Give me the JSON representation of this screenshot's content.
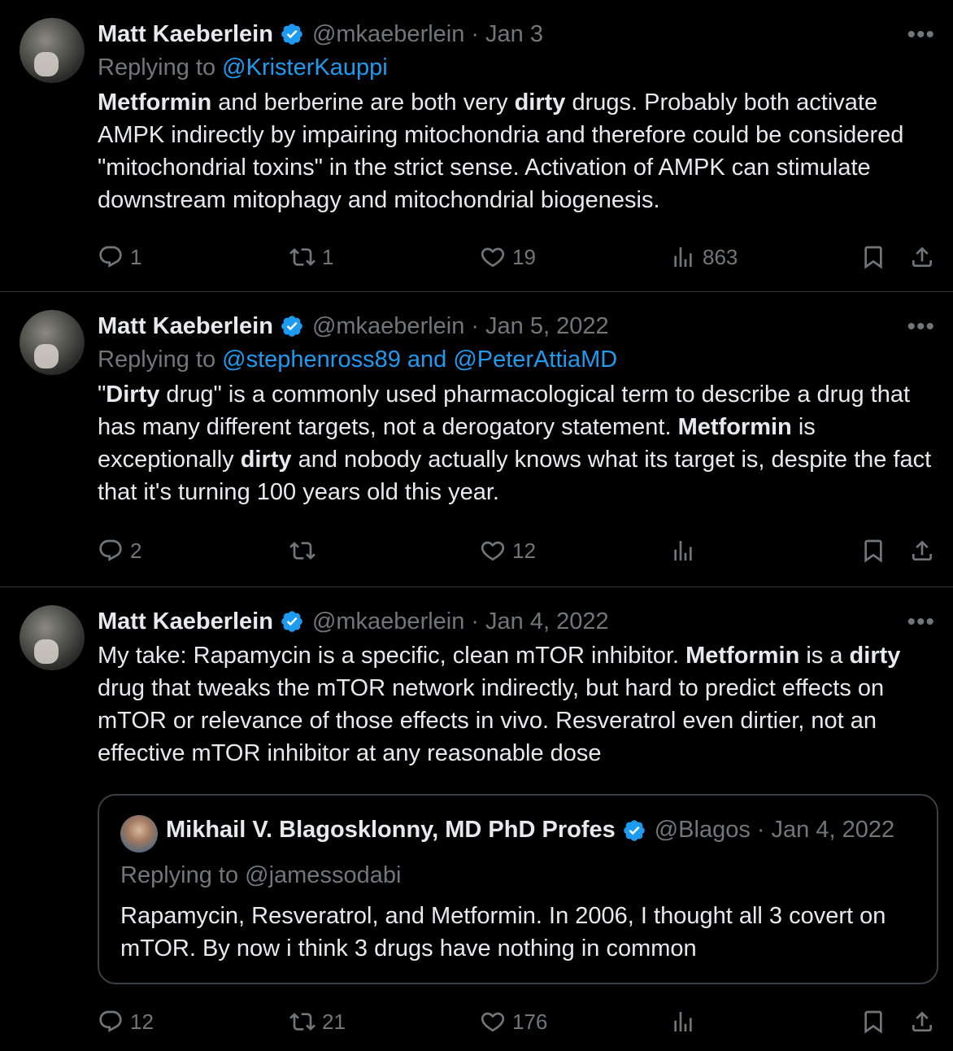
{
  "tweets": [
    {
      "name": "Matt Kaeberlein",
      "handle": "@mkaeberlein",
      "date": "Jan 3",
      "replying_prefix": "Replying to ",
      "replying_to": "@KristerKauppi",
      "text_parts": [
        {
          "b": "Metformin"
        },
        {
          "t": " and berberine are both very "
        },
        {
          "b": "dirty"
        },
        {
          "t": " drugs. Probably both activate AMPK indirectly by impairing mitochondria and therefore could be considered \"mitochondrial toxins\" in the strict sense.  Activation of AMPK can stimulate downstream mitophagy and mitochondrial biogenesis."
        }
      ],
      "replies": "1",
      "reposts": "1",
      "likes": "19",
      "views": "863"
    },
    {
      "name": "Matt Kaeberlein",
      "handle": "@mkaeberlein",
      "date": "Jan 5, 2022",
      "replying_prefix": "Replying to ",
      "replying_to": "@stephenross89 and @PeterAttiaMD",
      "text_parts": [
        {
          "t": "\""
        },
        {
          "b": "Dirty"
        },
        {
          "t": " drug\" is a commonly used pharmacological term to describe a drug that has many different targets, not a derogatory statement.  "
        },
        {
          "b": "Metformin"
        },
        {
          "t": " is exceptionally "
        },
        {
          "b": "dirty"
        },
        {
          "t": " and nobody actually knows what its target is, despite the fact that it's turning 100 years old this year."
        }
      ],
      "replies": "2",
      "reposts": "",
      "likes": "12",
      "views": ""
    },
    {
      "name": "Matt Kaeberlein",
      "handle": "@mkaeberlein",
      "date": "Jan 4, 2022",
      "text_parts": [
        {
          "t": "My take: Rapamycin is a specific, clean mTOR inhibitor.  "
        },
        {
          "b": "Metformin"
        },
        {
          "t": " is a "
        },
        {
          "b": "dirty"
        },
        {
          "t": " drug that tweaks the mTOR network indirectly, but hard to predict effects on mTOR or relevance of those effects in vivo.  Resveratrol even dirtier, not an effective mTOR inhibitor at any reasonable dose"
        }
      ],
      "quote": {
        "name": "Mikhail V. Blagosklonny, MD PhD Profes",
        "handle": "@Blagos",
        "date": "Jan 4, 2022",
        "replying": "Replying to @jamessodabi",
        "text": "Rapamycin, Resveratrol, and Metformin. In 2006, I thought all 3 covert on mTOR. By now i think 3 drugs have nothing in common"
      },
      "replies": "12",
      "reposts": "21",
      "likes": "176",
      "views": ""
    }
  ],
  "separator": "·",
  "more_label": "•••",
  "colors": {
    "background": "#000000",
    "text": "#e7e9ea",
    "muted": "#71767b",
    "link": "#1d9bf0",
    "verified": "#1d9bf0",
    "divider": "#2f3336"
  },
  "icons": [
    "verified-badge-icon",
    "reply-icon",
    "repost-icon",
    "like-icon",
    "views-icon",
    "bookmark-icon",
    "share-icon",
    "more-icon"
  ]
}
